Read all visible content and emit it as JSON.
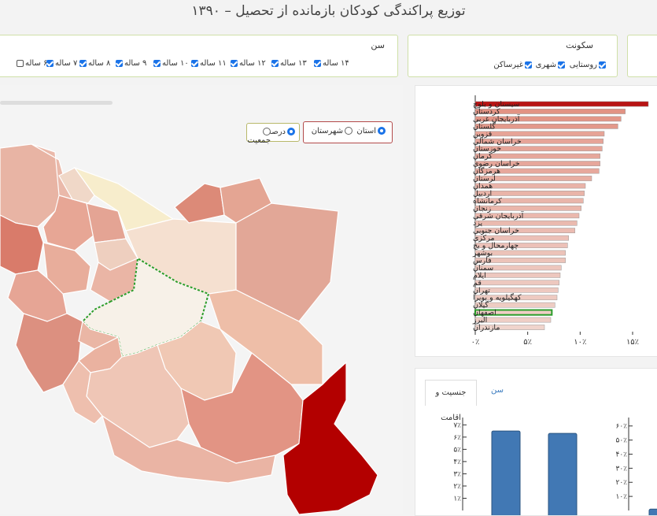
{
  "title": "توزیع پراکندگی کودکان بازمانده از تحصیل – ۱۳۹۰",
  "filters": {
    "residence": {
      "title": "سکونت",
      "options": [
        {
          "label": "روستایی",
          "checked": true
        },
        {
          "label": "شهری",
          "checked": true
        },
        {
          "label": "غیرساکن",
          "checked": true
        }
      ]
    },
    "age": {
      "title": "سن",
      "options": [
        {
          "label": "۶ ساله",
          "checked": false
        },
        {
          "label": "۷ ساله",
          "checked": true
        },
        {
          "label": "۸ ساله",
          "checked": true
        },
        {
          "label": "۹ ساله",
          "checked": true
        },
        {
          "label": "۱۰ ساله",
          "checked": true
        },
        {
          "label": "۱۱ ساله",
          "checked": true
        },
        {
          "label": "۱۲ ساله",
          "checked": true
        },
        {
          "label": "۱۳ ساله",
          "checked": true
        },
        {
          "label": "۱۴ ساله",
          "checked": true
        }
      ]
    }
  },
  "map_toggles": {
    "level": {
      "options": [
        "استان",
        "شهرستان"
      ],
      "selected": "استان"
    },
    "measure": {
      "options": [
        "جمعیت",
        "درصد"
      ],
      "selected": "درصد"
    }
  },
  "colors": {
    "accent": "#1a73e8",
    "map_max": "#b30000",
    "bar_max": "#b81414",
    "bar_high": "#de8878",
    "bar_mid": "#e5a898",
    "bar_low": "#f0d4cc",
    "highlight": "#2b9d2b",
    "bar_blue": "#4178b4"
  },
  "chart_data": [
    {
      "type": "bar",
      "orientation": "horizontal",
      "categories": [
        "سیستان و بلوچستان",
        "کردستان",
        "آذربایجان غربی",
        "گلستان",
        "قزوین",
        "خراسان شمالی",
        "خوزستان",
        "کرمان",
        "خراسان رضوی",
        "هرمزگان",
        "لرستان",
        "همدان",
        "اردبیل",
        "کرمانشاه",
        "زنجان",
        "آذربایجان شرقی",
        "یزد",
        "خراسان جنوبی",
        "مرکزی",
        "چهارمحال و بختیاری",
        "بوشهر",
        "فارس",
        "سمنان",
        "ایلام",
        "قم",
        "تهران",
        "کهگیلویه و بویراحمد",
        "گیلان",
        "اصفهان",
        "البرز",
        "مازندران"
      ],
      "category_labels": [
        "سیستان و بلوچ",
        "کردستان",
        "آذربایجان غربی",
        "گلستان",
        "قزوین",
        "خراسان شمالی",
        "خوزستان",
        "کرمان",
        "خراسان رضوی",
        "هرمزگان",
        "لرستان",
        "همدان",
        "اردبیل",
        "کرمانشاه",
        "زنجان",
        "آذربایجان شرقی",
        "یزد",
        "خراسان جنوبی",
        "مرکزی",
        "چهارمحال و بخ",
        "بوشهر",
        "فارس",
        "سمنان",
        "ایلام",
        "قم",
        "تهران",
        "کهگیلویه و بویرا",
        "گیلان",
        "اصفهان",
        "البرز",
        "مازندران"
      ],
      "values": [
        16.5,
        14.3,
        13.9,
        13.6,
        12.3,
        12.2,
        12.1,
        11.9,
        11.9,
        11.8,
        11.1,
        10.5,
        10.4,
        10.3,
        10.1,
        9.9,
        9.7,
        9.5,
        8.9,
        8.8,
        8.6,
        8.6,
        8.2,
        8.1,
        8.0,
        7.9,
        7.8,
        7.6,
        7.3,
        7.2,
        6.6
      ],
      "highlighted": "اصفهان",
      "x_ticks": [
        "۰٪",
        "۵٪",
        "۱۰٪",
        "۱۵٪"
      ],
      "x_tick_values": [
        0,
        5,
        10,
        15
      ],
      "xlim": [
        0,
        16.5
      ]
    },
    {
      "type": "bar",
      "categories": [
        "",
        ""
      ],
      "values": [
        6.5,
        6.3
      ],
      "y_ticks": [
        "۱٪",
        "۲٪",
        "۳٪",
        "۴٪",
        "۵٪",
        "۶٪",
        "۷٪"
      ],
      "y_tick_values": [
        1,
        2,
        3,
        4,
        5,
        6,
        7
      ],
      "ylim": [
        0,
        7.6
      ]
    },
    {
      "type": "bar",
      "categories": [
        ""
      ],
      "values": [
        1
      ],
      "y_ticks": [
        "۱۰٪",
        "۲۰٪",
        "۳۰٪",
        "۴۰٪",
        "۵۰٪",
        "۶۰٪"
      ],
      "y_tick_values": [
        10,
        20,
        30,
        40,
        50,
        60
      ],
      "ylim": [
        0,
        66
      ]
    }
  ],
  "lower_tabs": [
    {
      "label": "جنسیت و اقامت",
      "active": true
    },
    {
      "label": "سن",
      "active": false
    }
  ]
}
